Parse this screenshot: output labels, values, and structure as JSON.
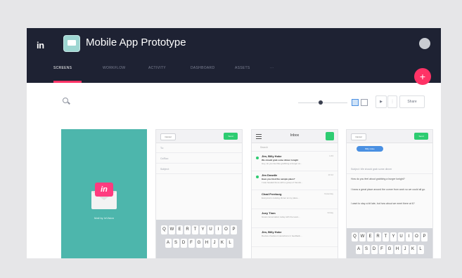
{
  "app": {
    "logo_text": "in",
    "project_title": "Mobile App Prototype"
  },
  "tabs": [
    {
      "label": "SCREENS",
      "active": true
    },
    {
      "label": "WORKFLOW",
      "active": false
    },
    {
      "label": "ACTIVITY",
      "active": false
    },
    {
      "label": "DASHBOARD",
      "active": false
    },
    {
      "label": "ASSETS",
      "active": false
    },
    {
      "label": "···",
      "active": false
    }
  ],
  "toolbar": {
    "add_icon": "plus-icon",
    "share_label": "Share"
  },
  "screens": {
    "splash": {
      "badge": "in",
      "caption": "Mail by InVision"
    },
    "compose": {
      "cancel": "Cancel",
      "send": "Send",
      "fields": [
        "To:",
        "Cc/Bcc:",
        "Subject:"
      ]
    },
    "inbox": {
      "title": "Inbox",
      "search_placeholder": "Search",
      "items": [
        {
          "from": "Jim, Billy Hoke",
          "time": "1:43",
          "subject": "We should grab some dinner tonight",
          "preview": "Hey, do you feel like grabbing a burger at..."
        },
        {
          "from": "Jim Dowdle",
          "time": "10:12",
          "subject": "Have you tried the sample place?",
          "preview": "I was headed there with a group of friends..."
        },
        {
          "from": "Chad Freeburg",
          "time": "Yesterday",
          "subject": "",
          "preview": "Everyone's cooking dinner at my place..."
        },
        {
          "from": "Joey Tinm",
          "time": "Friday",
          "subject": "",
          "preview": "Great conversation today with the team..."
        },
        {
          "from": "Jim, Billy Hoke",
          "time": "",
          "subject": "",
          "preview": "Review checkout interactions in feedback..."
        }
      ]
    },
    "reply": {
      "cancel": "Cancel",
      "send": "Send",
      "to_chip": "Billy Hoke",
      "subject": "Subject: We should grab some dinner",
      "body": [
        "How do you feel about grabbing a burger tonight?",
        "I know a great place around the corner from work so we could all go.",
        "I want to stay a bit late, but how about we meet there at 6?"
      ]
    },
    "keyboard_rows": [
      [
        "Q",
        "W",
        "E",
        "R",
        "T",
        "Y",
        "U",
        "I",
        "O",
        "P"
      ],
      [
        "A",
        "S",
        "D",
        "F",
        "G",
        "H",
        "J",
        "K",
        "L"
      ]
    ]
  },
  "colors": {
    "topbar": "#1e2233",
    "accent": "#ff3366",
    "teal": "#4db6ac",
    "green": "#2ecc71"
  }
}
